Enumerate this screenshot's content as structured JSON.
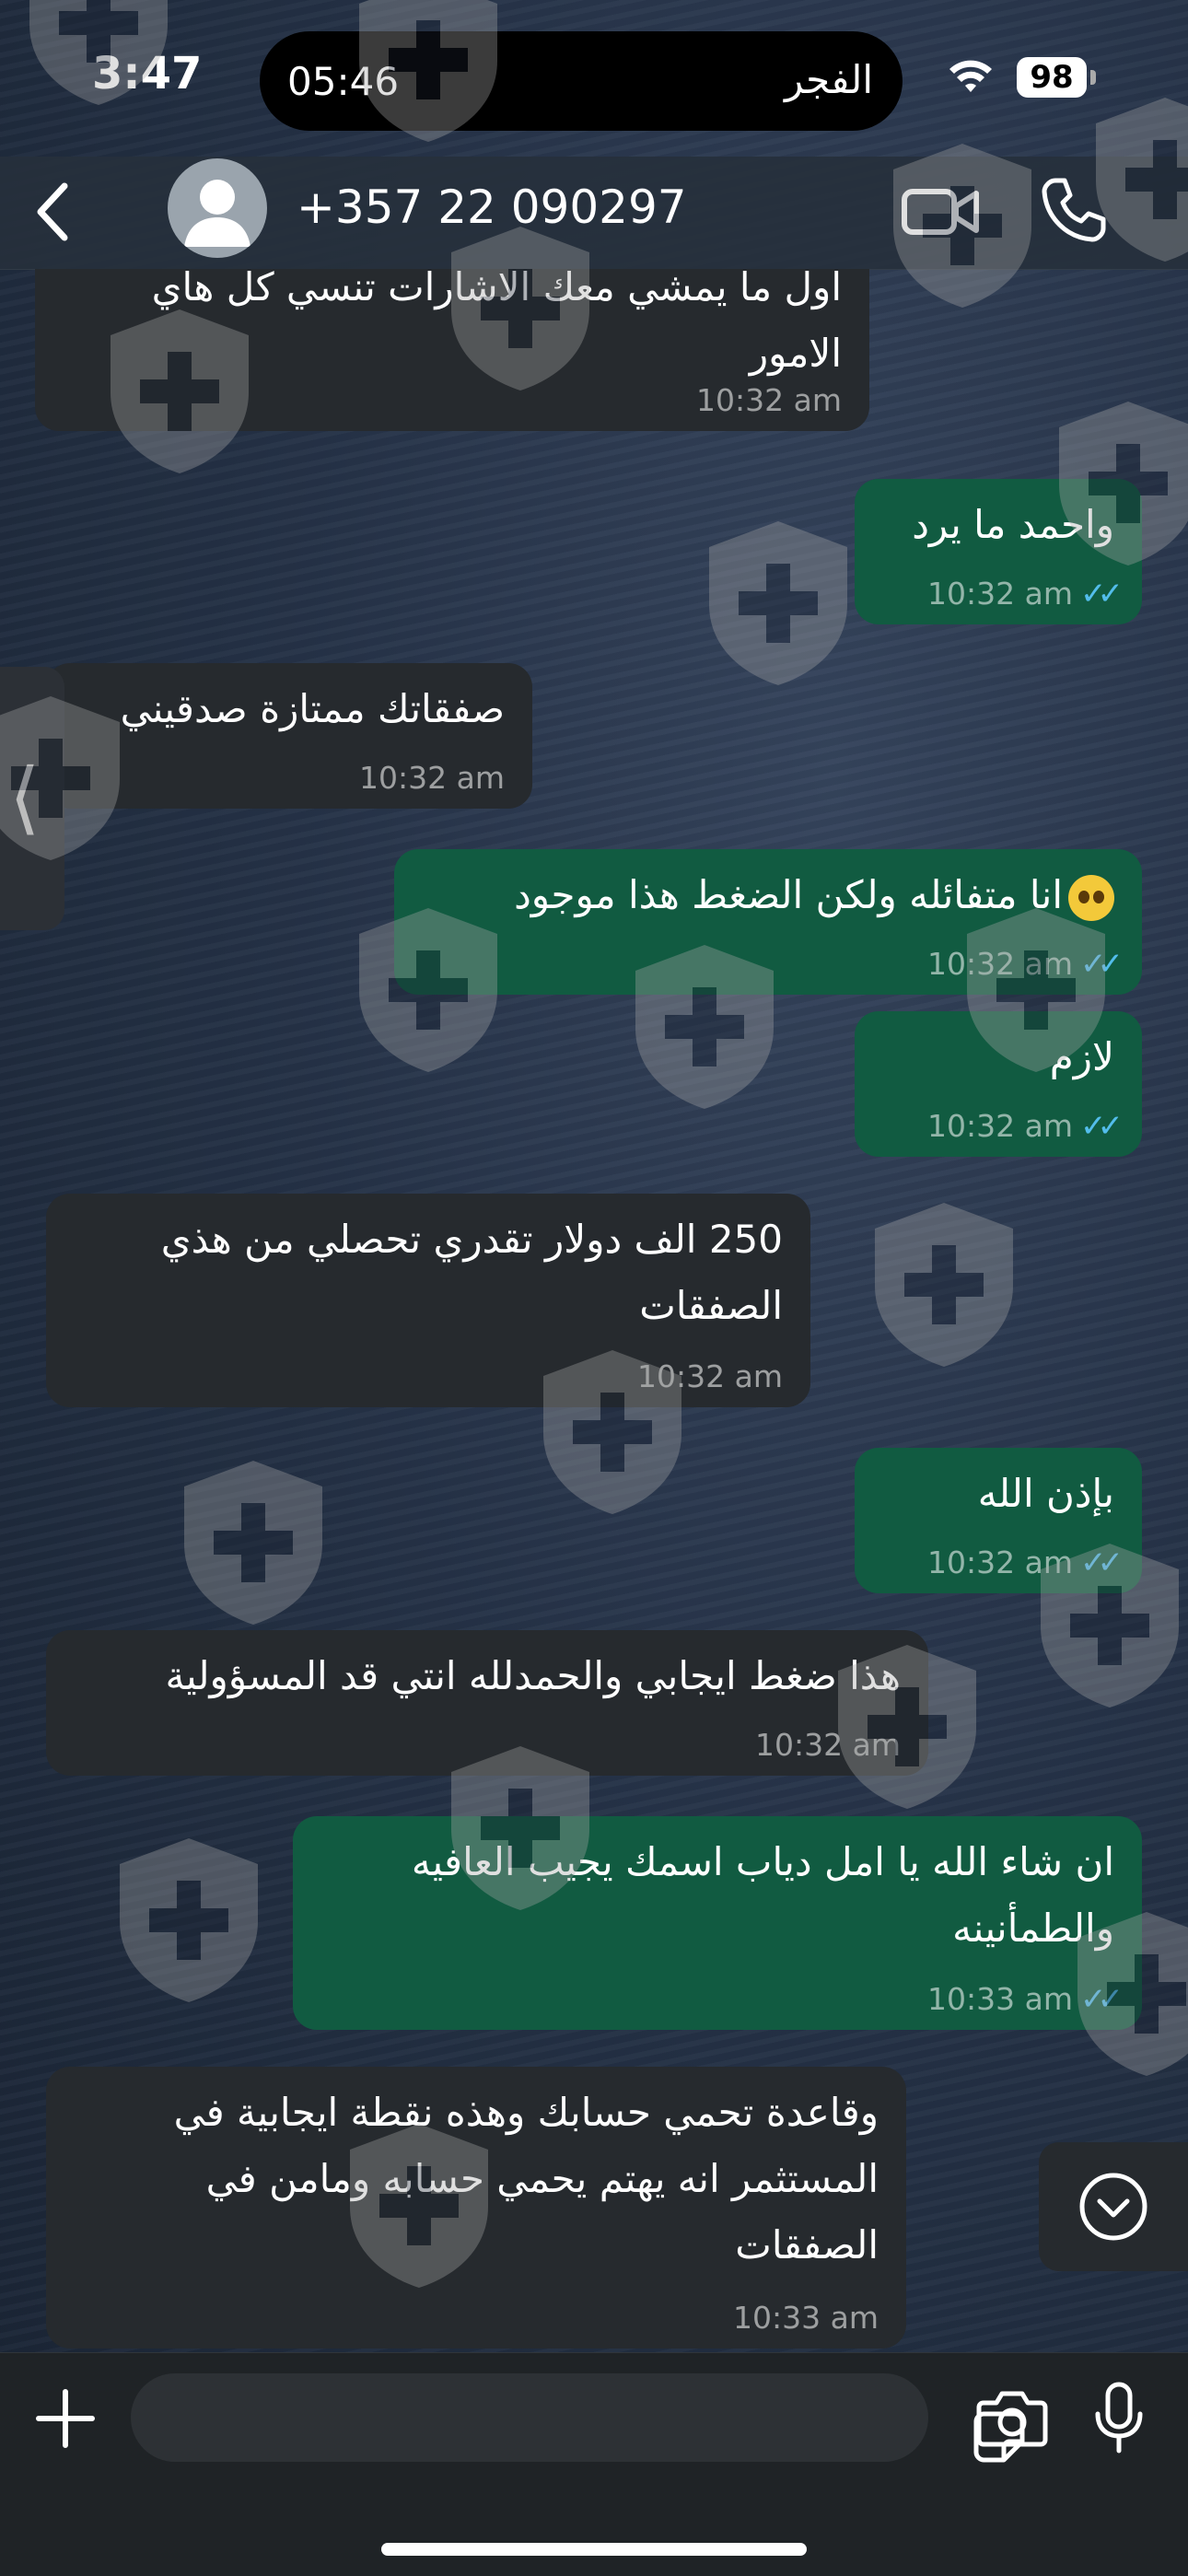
{
  "status": {
    "clock": "3:47",
    "island_time": "05:46",
    "island_prayer": "الفجر",
    "battery": "98"
  },
  "header": {
    "contact_name": "+357 22 090297"
  },
  "messages": [
    {
      "dir": "in",
      "lines": [
        "اول ما يمشي معك الاشارات تنسي كل هاي",
        "الامور"
      ],
      "time": "10:32 am"
    },
    {
      "dir": "out",
      "lines": [
        "واحمد ما يرد"
      ],
      "time": "10:32 am"
    },
    {
      "dir": "in",
      "lines": [
        "صفقاتك ممتازة صدقيني"
      ],
      "time": "10:32 am"
    },
    {
      "dir": "out",
      "lines": [
        "انا متفائله ولكن الضغط هذا موجود"
      ],
      "time": "10:32 am",
      "emoji": "face-holding-back-tears"
    },
    {
      "dir": "out",
      "lines": [
        "لازم"
      ],
      "time": "10:32 am"
    },
    {
      "dir": "in",
      "lines": [
        "250 الف دولار تقدري تحصلي من هذي",
        "الصفقات"
      ],
      "time": "10:32 am"
    },
    {
      "dir": "out",
      "lines": [
        "بإذن الله"
      ],
      "time": "10:32 am"
    },
    {
      "dir": "in",
      "lines": [
        "هذا ضغط ايجابي والحمدلله انتي قد المسؤولية"
      ],
      "time": "10:32 am"
    },
    {
      "dir": "out",
      "lines": [
        "ان شاء الله يا امل دياب اسمك يجيب العافيه",
        "والطمأنينه"
      ],
      "time": "10:33 am"
    },
    {
      "dir": "in",
      "lines": [
        "وقاعدة تحمي حسابك وهذه نقطة ايجابية في",
        "المستثمر انه يهتم يحمي حسابه ومامن في",
        "الصفقات"
      ],
      "time": "10:33 am"
    }
  ],
  "read_ticks": "✓✓",
  "colors": {
    "incoming_bubble": "#262a2e",
    "outgoing_bubble": "#115b41",
    "read_ticks": "#53bdeb",
    "watermark": "#a8a8a8"
  },
  "icons": [
    "back-arrow-icon",
    "avatar-placeholder-icon",
    "video-call-icon",
    "voice-call-icon",
    "chevron-left-icon",
    "chevron-down-circle-icon",
    "plus-icon",
    "sticker-icon",
    "camera-icon",
    "microphone-icon",
    "shield-cross-watermark"
  ]
}
